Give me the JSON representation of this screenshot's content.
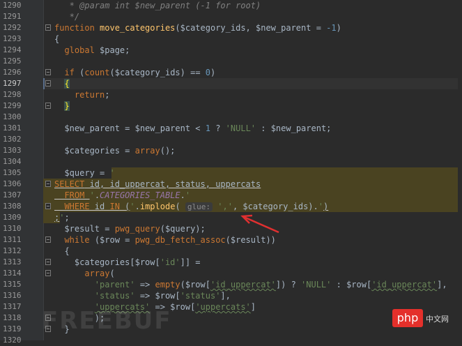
{
  "editor": {
    "lines": [
      {
        "n": "1290",
        "tokens": [
          [
            "cmtdoc",
            "   * @param int $new_parent (-1 for root)"
          ]
        ]
      },
      {
        "n": "1291",
        "tokens": [
          [
            "cmtdoc",
            "   */"
          ]
        ]
      },
      {
        "n": "1292",
        "tokens": [
          [
            "kw",
            "function "
          ],
          [
            "fn",
            "move_categories"
          ],
          [
            "var",
            "($category_ids, $new_parent = "
          ],
          [
            "num",
            "-1"
          ],
          [
            "var",
            ")"
          ]
        ]
      },
      {
        "n": "1293",
        "tokens": [
          [
            "var",
            "{"
          ]
        ]
      },
      {
        "n": "1294",
        "tokens": [
          [
            "var",
            "  "
          ],
          [
            "kw",
            "global "
          ],
          [
            "var",
            "$page;"
          ]
        ]
      },
      {
        "n": "1295",
        "tokens": []
      },
      {
        "n": "1296",
        "tokens": [
          [
            "var",
            "  "
          ],
          [
            "kw",
            "if "
          ],
          [
            "var",
            "("
          ],
          [
            "kw",
            "count"
          ],
          [
            "var",
            "($category_ids) == "
          ],
          [
            "num",
            "0"
          ],
          [
            "var",
            ")"
          ]
        ]
      },
      {
        "n": "1297",
        "tokens": [
          [
            "var",
            "  "
          ],
          [
            "bracematch",
            "{"
          ]
        ]
      },
      {
        "n": "1298",
        "tokens": [
          [
            "var",
            "    "
          ],
          [
            "kw",
            "return"
          ],
          [
            "var",
            ";"
          ]
        ]
      },
      {
        "n": "1299",
        "tokens": [
          [
            "var",
            "  "
          ],
          [
            "bracematch",
            "}"
          ]
        ]
      },
      {
        "n": "1300",
        "tokens": []
      },
      {
        "n": "1301",
        "tokens": [
          [
            "var",
            "  $new_parent = $new_parent < "
          ],
          [
            "num",
            "1"
          ],
          [
            "var",
            " ? "
          ],
          [
            "str",
            "'NULL'"
          ],
          [
            "var",
            " : $new_parent;"
          ]
        ]
      },
      {
        "n": "1302",
        "tokens": []
      },
      {
        "n": "1303",
        "tokens": [
          [
            "var",
            "  $categories = "
          ],
          [
            "kw",
            "array"
          ],
          [
            "var",
            "();"
          ]
        ]
      },
      {
        "n": "1304",
        "tokens": []
      },
      {
        "n": "1305",
        "tokens": [
          [
            "var",
            "  $query = "
          ],
          [
            "str",
            "'"
          ]
        ]
      },
      {
        "n": "1306",
        "tokens": [
          [
            "sqlkw",
            "SELECT"
          ],
          [
            "sql",
            " id, id_uppercat, status, uppercats"
          ]
        ]
      },
      {
        "n": "1307",
        "tokens": [
          [
            "sqlkw",
            "  FROM "
          ],
          [
            "str",
            "'"
          ],
          [
            "var",
            "."
          ],
          [
            "const",
            "CATEGORIES_TABLE"
          ],
          [
            "var",
            "."
          ],
          [
            "str",
            "'"
          ]
        ]
      },
      {
        "n": "1308",
        "tokens": [
          [
            "sqlkw",
            "  WHERE"
          ],
          [
            "sql",
            " id "
          ],
          [
            "sqlkw",
            "IN"
          ],
          [
            "sql",
            " ("
          ],
          [
            "str",
            "'"
          ],
          [
            "var",
            "."
          ],
          [
            "fn",
            "implode"
          ],
          [
            "var",
            "( "
          ],
          [
            "hint",
            "glue:"
          ],
          [
            "var",
            " "
          ],
          [
            "str",
            "','"
          ],
          [
            "var",
            ", $category_ids)."
          ],
          [
            "str",
            "'"
          ],
          [
            "sql",
            ")"
          ]
        ]
      },
      {
        "n": "1309",
        "tokens": [
          [
            "sql",
            ";"
          ],
          [
            "str",
            "'"
          ],
          [
            "var",
            ";"
          ]
        ]
      },
      {
        "n": "1310",
        "tokens": [
          [
            "var",
            "  $result = "
          ],
          [
            "kw",
            "pwg_query"
          ],
          [
            "var",
            "($query);"
          ]
        ]
      },
      {
        "n": "1311",
        "tokens": [
          [
            "var",
            "  "
          ],
          [
            "kw",
            "while "
          ],
          [
            "var",
            "($row = "
          ],
          [
            "kw",
            "pwg_db_fetch_assoc"
          ],
          [
            "var",
            "($result))"
          ]
        ]
      },
      {
        "n": "1312",
        "tokens": [
          [
            "var",
            "  {"
          ]
        ]
      },
      {
        "n": "1313",
        "tokens": [
          [
            "var",
            "    $categories[$row["
          ],
          [
            "str",
            "'id'"
          ],
          [
            "var",
            "]] ="
          ]
        ]
      },
      {
        "n": "1314",
        "tokens": [
          [
            "var",
            "      "
          ],
          [
            "kw",
            "array"
          ],
          [
            "var",
            "("
          ]
        ]
      },
      {
        "n": "1315",
        "tokens": [
          [
            "var",
            "        "
          ],
          [
            "str",
            "'parent'"
          ],
          [
            "var",
            " => "
          ],
          [
            "kw",
            "empty"
          ],
          [
            "var",
            "($row["
          ],
          [
            "key",
            "'id_uppercat'"
          ],
          [
            "var",
            "]) ? "
          ],
          [
            "str",
            "'NULL'"
          ],
          [
            "var",
            " : $row["
          ],
          [
            "key",
            "'id_uppercat'"
          ],
          [
            "var",
            "],"
          ]
        ]
      },
      {
        "n": "1316",
        "tokens": [
          [
            "var",
            "        "
          ],
          [
            "str",
            "'status'"
          ],
          [
            "var",
            " => $row["
          ],
          [
            "str",
            "'status'"
          ],
          [
            "var",
            "],"
          ]
        ]
      },
      {
        "n": "1317",
        "tokens": [
          [
            "var",
            "        "
          ],
          [
            "key",
            "'uppercats'"
          ],
          [
            "var",
            " => $row["
          ],
          [
            "key",
            "'uppercats'"
          ],
          [
            "var",
            "]"
          ]
        ]
      },
      {
        "n": "1318",
        "tokens": [
          [
            "var",
            "        );"
          ]
        ]
      },
      {
        "n": "1319",
        "tokens": [
          [
            "var",
            "  }"
          ]
        ]
      },
      {
        "n": "1320",
        "tokens": []
      }
    ],
    "current_line": "1297",
    "highlight_lines": [
      "1306",
      "1307",
      "1308"
    ],
    "highlight_partial": {
      "1305": "tail",
      "1309": "head"
    }
  },
  "watermark": {
    "brand": "FREEBUF",
    "site_badge": "php",
    "site_text": "中文网"
  },
  "colors": {
    "background": "#2b2b2b",
    "keyword": "#cc7832",
    "string": "#6a8759",
    "number": "#6897bb",
    "function": "#ffc66d",
    "highlight": "#4a4321",
    "arrow": "#e03030"
  }
}
